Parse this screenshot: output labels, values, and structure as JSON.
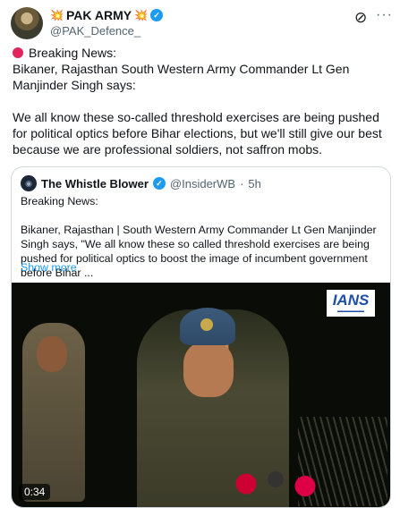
{
  "post": {
    "author_name": "PAK ARMY",
    "author_emoji": "💥",
    "handle": "@PAK_Defence_",
    "body_text": "Breaking News:\nBikaner, Rajasthan South Western Army Commander Lt Gen Manjinder Singh says:\n\nWe all know these so-called threshold exercises are being pushed for political optics before Bihar elections, but we'll still give our best because we are professional soldiers, not saffron mobs."
  },
  "quote": {
    "author_name": "The Whistle Blower",
    "handle": "@InsiderWB",
    "separator": "·",
    "time": "5h",
    "text": "Breaking News:\n\nBikaner, Rajasthan | South Western Army Commander Lt Gen Manjinder Singh says, \"We all know these so called threshold exercises are being pushed for political optics to boost the image of incumbent government before Bihar ...",
    "show_more": "Show more",
    "video": {
      "logo": "IANS",
      "duration": "0:34"
    }
  },
  "icons": {
    "verified": "verified-badge-icon",
    "grok": "grok-icon",
    "more": "more-options-icon",
    "alert": "red-circle-icon"
  },
  "colors": {
    "accent": "#1d9bf0",
    "alert": "#e0245e"
  }
}
